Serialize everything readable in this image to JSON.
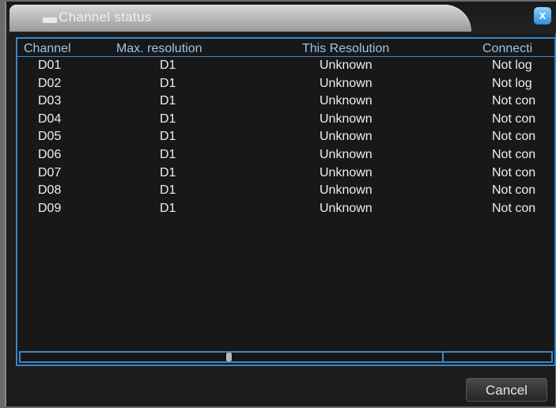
{
  "window": {
    "title": "Channel status",
    "close_label": "x"
  },
  "table": {
    "headers": {
      "channel": "Channel",
      "max_resolution": "Max. resolution",
      "this_resolution": "This Resolution",
      "connection": "Connecti"
    },
    "rows": [
      {
        "channel": "D01",
        "max": "D1",
        "this": "Unknown",
        "conn": "Not log"
      },
      {
        "channel": "D02",
        "max": "D1",
        "this": "Unknown",
        "conn": "Not log"
      },
      {
        "channel": "D03",
        "max": "D1",
        "this": "Unknown",
        "conn": "Not con"
      },
      {
        "channel": "D04",
        "max": "D1",
        "this": "Unknown",
        "conn": "Not con"
      },
      {
        "channel": "D05",
        "max": "D1",
        "this": "Unknown",
        "conn": "Not con"
      },
      {
        "channel": "D06",
        "max": "D1",
        "this": "Unknown",
        "conn": "Not con"
      },
      {
        "channel": "D07",
        "max": "D1",
        "this": "Unknown",
        "conn": "Not con"
      },
      {
        "channel": "D08",
        "max": "D1",
        "this": "Unknown",
        "conn": "Not con"
      },
      {
        "channel": "D09",
        "max": "D1",
        "this": "Unknown",
        "conn": "Not con"
      }
    ]
  },
  "footer": {
    "cancel_label": "Cancel"
  },
  "icons": {
    "title": "window-icon",
    "close": "close-icon"
  },
  "colors": {
    "accent": "#3b86c4",
    "close_button": "#2f8fe0"
  }
}
